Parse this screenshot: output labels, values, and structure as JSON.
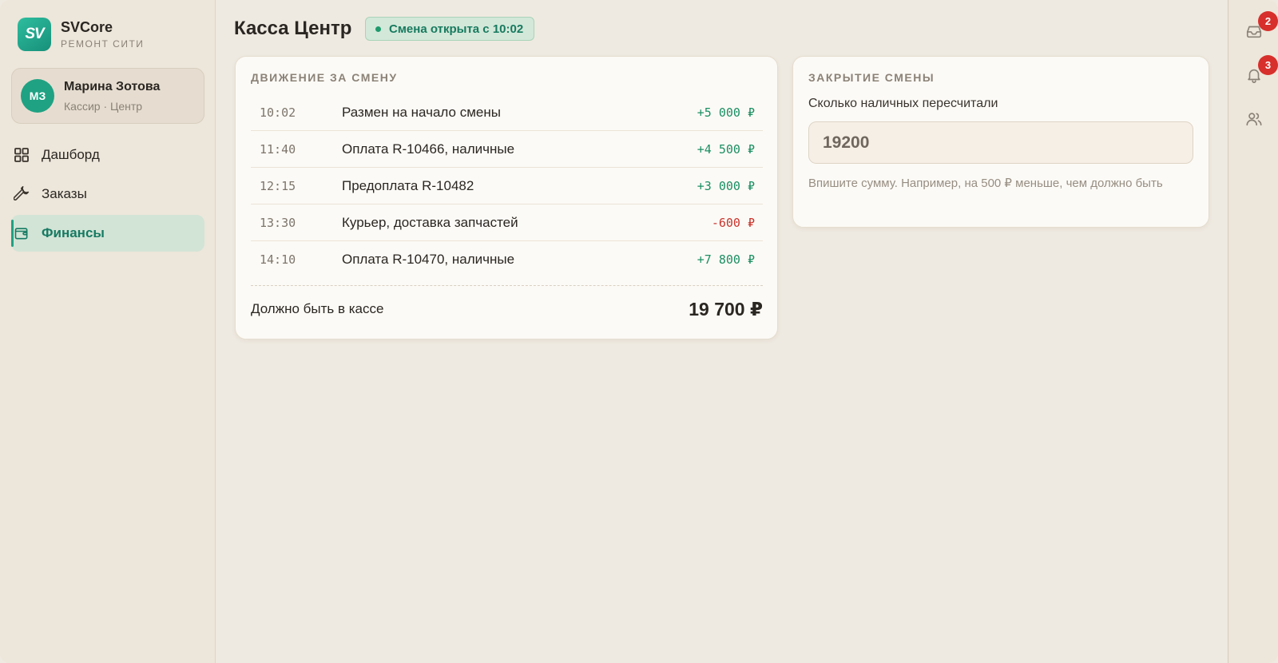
{
  "brand": {
    "logo_text": "SV",
    "name": "SVCore",
    "subtitle": "РЕМОНТ СИТИ",
    "accent_color": "#1fa283"
  },
  "user": {
    "initials": "МЗ",
    "name": "Марина Зотова",
    "role": "Кассир · Центр"
  },
  "nav": {
    "items": [
      {
        "label": "Дашборд",
        "icon": "grid-icon",
        "active": false
      },
      {
        "label": "Заказы",
        "icon": "wrench-icon",
        "active": false
      },
      {
        "label": "Финансы",
        "icon": "wallet-icon",
        "active": true
      }
    ]
  },
  "header": {
    "title": "Касса Центр",
    "status": "Смена открыта с 10:02"
  },
  "movements": {
    "heading": "ДВИЖЕНИЕ ЗА СМЕНУ",
    "rows": [
      {
        "time": "10:02",
        "description": "Размен на начало смены",
        "amount": "+5 000 ₽",
        "direction": "in"
      },
      {
        "time": "11:40",
        "description": "Оплата R-10466, наличные",
        "amount": "+4 500 ₽",
        "direction": "in"
      },
      {
        "time": "12:15",
        "description": "Предоплата R-10482",
        "amount": "+3 000 ₽",
        "direction": "in"
      },
      {
        "time": "13:30",
        "description": "Курьер, доставка запчастей",
        "amount": "-600 ₽",
        "direction": "out"
      },
      {
        "time": "14:10",
        "description": "Оплата R-10470, наличные",
        "amount": "+7 800 ₽",
        "direction": "in"
      }
    ],
    "total_label": "Должно быть в кассе",
    "total_value": "19 700 ₽"
  },
  "close_shift": {
    "heading": "ЗАКРЫТИЕ СМЕНЫ",
    "field_label": "Сколько наличных пересчитали",
    "input_value": "19200",
    "hint": "Впишите сумму. Например, на 500 ₽ меньше, чем должно быть"
  },
  "rail": {
    "inbox_badge": "2",
    "notifications_badge": "3"
  },
  "colors": {
    "positive": "#1b8f63",
    "negative": "#c8352d",
    "badge_red": "#d72f2b"
  }
}
